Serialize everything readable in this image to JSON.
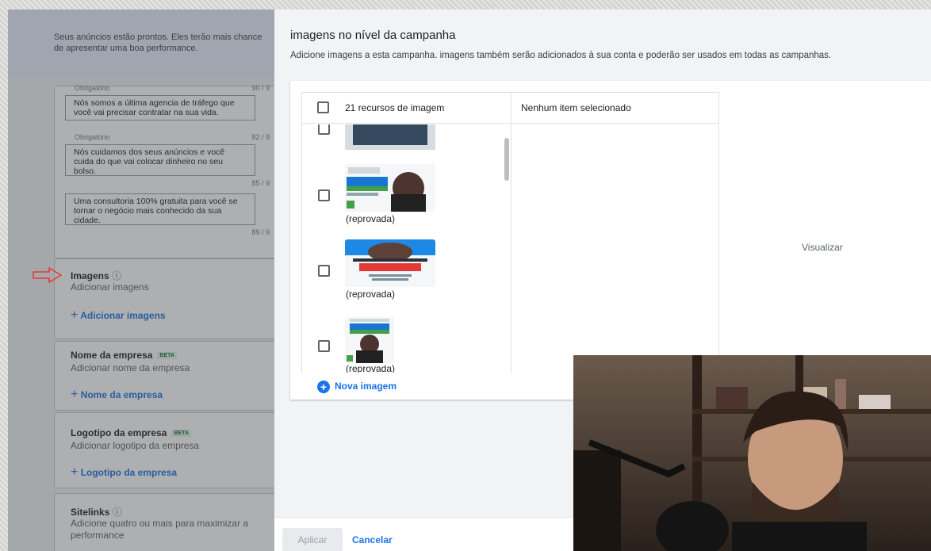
{
  "left_panel": {
    "notice": "Seus anúncios estão prontos. Eles terão mais chance de apresentar uma boa performance.",
    "descriptions": [
      {
        "meta": "Obrigatório",
        "count": "90 / 9",
        "text": "Nós somos a última agencia de tráfego que você vai precisar contratar na sua vida."
      },
      {
        "meta": "Obrigatório",
        "count": "82 / 9",
        "text": "Nós cuidamos dos seus anúncios e você cuida do que vai colocar dinheiro no seu bolso."
      },
      {
        "meta": "",
        "count": "85 / 9",
        "text": "Uma consultoria 100% gratuita para você se tornar o negócio mais conhecido da sua cidade."
      },
      {
        "meta": "",
        "count": "89 / 9",
        "text": ""
      }
    ],
    "sections": [
      {
        "title": "Imagens",
        "sub": "Adicionar imagens",
        "add": "Adicionar imagens",
        "beta": ""
      },
      {
        "title": "Nome da empresa",
        "sub": "Adicionar nome da empresa",
        "add": "Nome da empresa",
        "beta": "BETA"
      },
      {
        "title": "Logotipo da empresa",
        "sub": "Adicionar logotipo da empresa",
        "add": "Logotipo da empresa",
        "beta": "BETA"
      },
      {
        "title": "Sitelinks",
        "sub": "Adicione quatro ou mais para maximizar a performance",
        "add": "",
        "beta": ""
      }
    ]
  },
  "dialog": {
    "title": "imagens no nível da campanha",
    "subtitle": "Adicione imagens a esta campanha. imagens também serão adicionados à sua conta e poderão ser usados em todas as campanhas.",
    "list_header": "21 recursos de imagem",
    "selected_header": "Nenhum item selecionado",
    "preview_label": "Visualizar",
    "items": [
      {
        "status": "(reprovada)",
        "headline": "PRÓXIMA",
        "banner": "TERÇA ÀS 15H"
      },
      {
        "status": "(reprovada)",
        "headline": "EU ESTAREI LÁ.",
        "banner": "QUANDO VOCÊ ENTRAR NA INTERNET,"
      },
      {
        "status": "(reprovada)",
        "headline": "PRÓXIMA",
        "banner": "TERÇA ÀS 15H"
      }
    ],
    "new_image": "Nova imagem",
    "apply": "Aplicar",
    "cancel": "Cancelar"
  },
  "colors": {
    "accent": "#1a73e8",
    "alert_red": "#e53935",
    "banner_green": "#43a047",
    "banner_blue": "#1976d2"
  }
}
